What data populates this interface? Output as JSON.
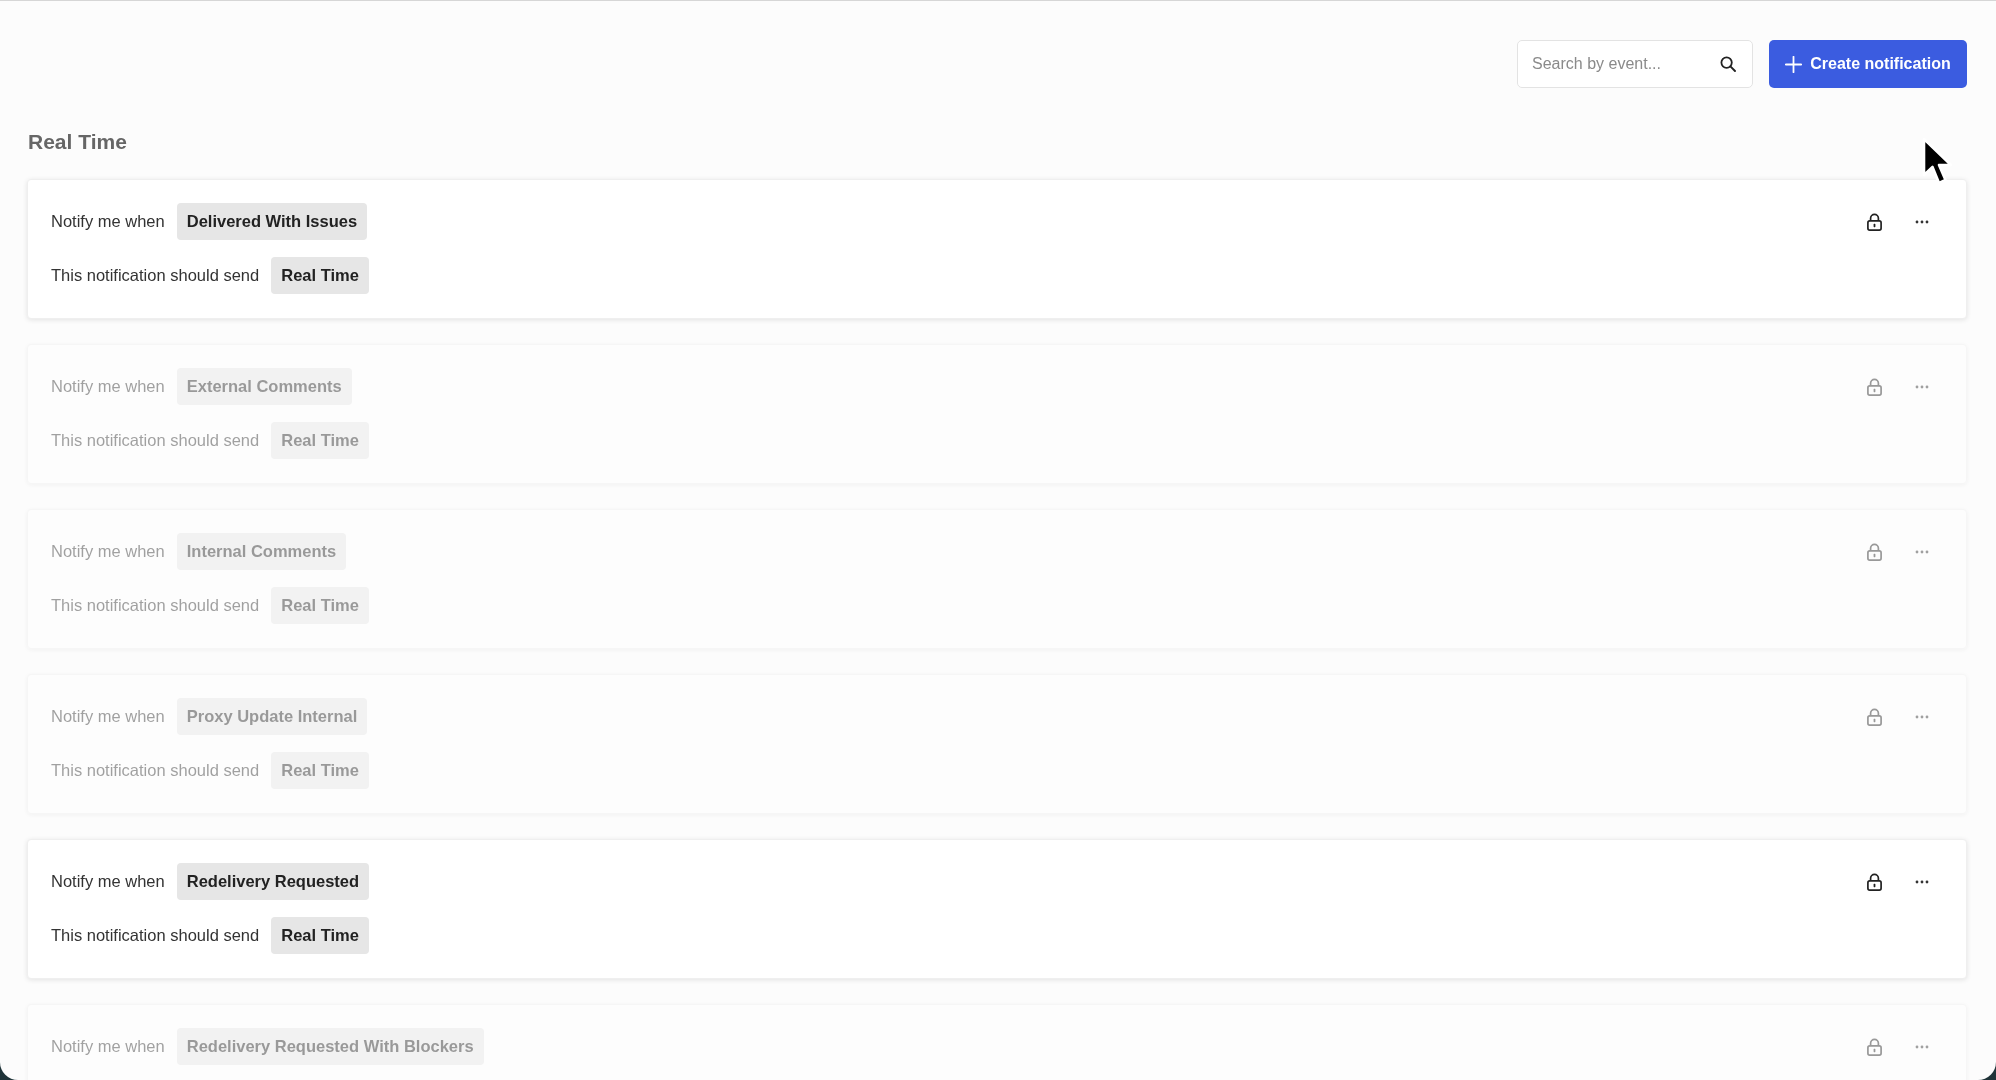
{
  "search": {
    "placeholder": "Search by event..."
  },
  "create_button": {
    "label": "Create notification"
  },
  "section": {
    "title": "Real Time",
    "notifications": [
      {
        "trigger_label": "Notify me when",
        "event": "Delivered With Issues",
        "frequency_label": "This notification should send",
        "frequency": "Real Time",
        "disabled": false
      },
      {
        "trigger_label": "Notify me when",
        "event": "External Comments",
        "frequency_label": "This notification should send",
        "frequency": "Real Time",
        "disabled": true
      },
      {
        "trigger_label": "Notify me when",
        "event": "Internal Comments",
        "frequency_label": "This notification should send",
        "frequency": "Real Time",
        "disabled": true
      },
      {
        "trigger_label": "Notify me when",
        "event": "Proxy Update Internal",
        "frequency_label": "This notification should send",
        "frequency": "Real Time",
        "disabled": true
      },
      {
        "trigger_label": "Notify me when",
        "event": "Redelivery Requested",
        "frequency_label": "This notification should send",
        "frequency": "Real Time",
        "disabled": false
      },
      {
        "trigger_label": "Notify me when",
        "event": "Redelivery Requested With Blockers",
        "disabled": true
      }
    ]
  }
}
